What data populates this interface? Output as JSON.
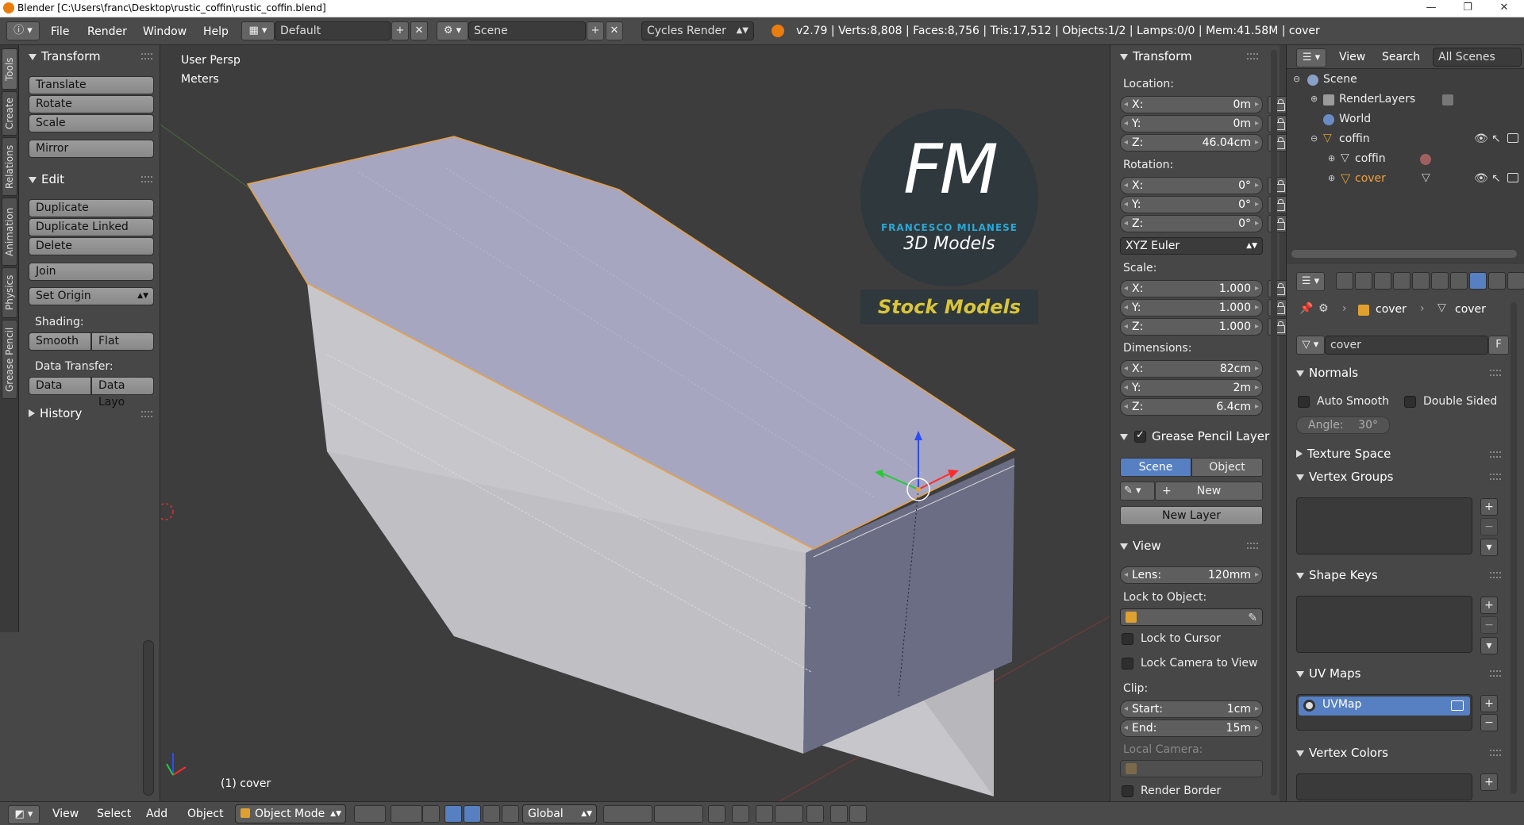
{
  "window": {
    "title": "Blender [C:\\Users\\franc\\Desktop\\rustic_coffin\\rustic_coffin.blend]",
    "minimize": "—",
    "maximize": "❐",
    "close": "✕"
  },
  "infobar": {
    "menus": [
      "File",
      "Render",
      "Window",
      "Help"
    ],
    "layout": "Default",
    "scene": "Scene",
    "engine": "Cycles Render",
    "stats": "v2.79 | Verts:8,808 | Faces:8,756 | Tris:17,512 | Objects:1/2 | Lamps:0/0 | Mem:41.58M | cover"
  },
  "tabs": [
    "Tools",
    "Create",
    "Relations",
    "Animation",
    "Physics",
    "Grease Pencil"
  ],
  "toolshelf": {
    "transform_title": "Transform",
    "translate": "Translate",
    "rotate": "Rotate",
    "scale": "Scale",
    "mirror": "Mirror",
    "edit_title": "Edit",
    "duplicate": "Duplicate",
    "duplicate_linked": "Duplicate Linked",
    "delete": "Delete",
    "join": "Join",
    "set_origin": "Set Origin",
    "shading_label": "Shading:",
    "smooth": "Smooth",
    "flat": "Flat",
    "data_transfer_label": "Data Transfer:",
    "data": "Data",
    "data_layo": "Data Layo",
    "history_title": "History"
  },
  "viewport": {
    "view_name": "User Persp",
    "units": "Meters",
    "object_label": "(1) cover",
    "logo_letters": "FM",
    "logo_name": "FRANCESCO MILANESE",
    "logo_sub": "3D Models",
    "stock_label": "Stock Models"
  },
  "npanel": {
    "transform_title": "Transform",
    "location_label": "Location:",
    "loc": [
      {
        "k": "X:",
        "v": "0m"
      },
      {
        "k": "Y:",
        "v": "0m"
      },
      {
        "k": "Z:",
        "v": "46.04cm"
      }
    ],
    "rotation_label": "Rotation:",
    "rot": [
      {
        "k": "X:",
        "v": "0°"
      },
      {
        "k": "Y:",
        "v": "0°"
      },
      {
        "k": "Z:",
        "v": "0°"
      }
    ],
    "rotation_mode": "XYZ Euler",
    "scale_label": "Scale:",
    "scale": [
      {
        "k": "X:",
        "v": "1.000"
      },
      {
        "k": "Y:",
        "v": "1.000"
      },
      {
        "k": "Z:",
        "v": "1.000"
      }
    ],
    "dimensions_label": "Dimensions:",
    "dim": [
      {
        "k": "X:",
        "v": "82cm"
      },
      {
        "k": "Y:",
        "v": "2m"
      },
      {
        "k": "Z:",
        "v": "6.4cm"
      }
    ],
    "grease_title": "Grease Pencil Layer",
    "gp_scene": "Scene",
    "gp_object": "Object",
    "gp_new": "New",
    "gp_new_layer": "New Layer",
    "view_title": "View",
    "lens_k": "Lens:",
    "lens_v": "120mm",
    "lock_to_object": "Lock to Object:",
    "lock_to_cursor": "Lock to Cursor",
    "lock_camera": "Lock Camera to View",
    "clip_label": "Clip:",
    "clip_start_k": "Start:",
    "clip_start_v": "1cm",
    "clip_end_k": "End:",
    "clip_end_v": "15m",
    "local_camera": "Local Camera:",
    "render_border": "Render Border"
  },
  "outliner": {
    "view": "View",
    "search": "Search",
    "filter": "All Scenes",
    "rows": [
      {
        "label": "Scene"
      },
      {
        "label": "RenderLayers"
      },
      {
        "label": "World"
      },
      {
        "label": "coffin"
      },
      {
        "label": "coffin"
      },
      {
        "label": "cover"
      }
    ]
  },
  "properties": {
    "breadcrumb_obj": "cover",
    "breadcrumb_data": "cover",
    "mesh_name": "cover",
    "fake_user": "F",
    "normals_title": "Normals",
    "auto_smooth": "Auto Smooth",
    "double_sided": "Double Sided",
    "angle_k": "Angle:",
    "angle_v": "30°",
    "texture_space": "Texture Space",
    "vertex_groups": "Vertex Groups",
    "shape_keys": "Shape Keys",
    "uv_maps": "UV Maps",
    "uv_map_name": "UVMap",
    "vertex_colors": "Vertex Colors"
  },
  "bottombar": {
    "view": "View",
    "select": "Select",
    "add": "Add",
    "object": "Object",
    "mode": "Object Mode",
    "orientation": "Global"
  },
  "colors": {
    "selection_outline": "#e8a040",
    "active_blue": "#5680c2",
    "panel_bg": "#474747",
    "viewport_bg": "#3d3d3d"
  }
}
